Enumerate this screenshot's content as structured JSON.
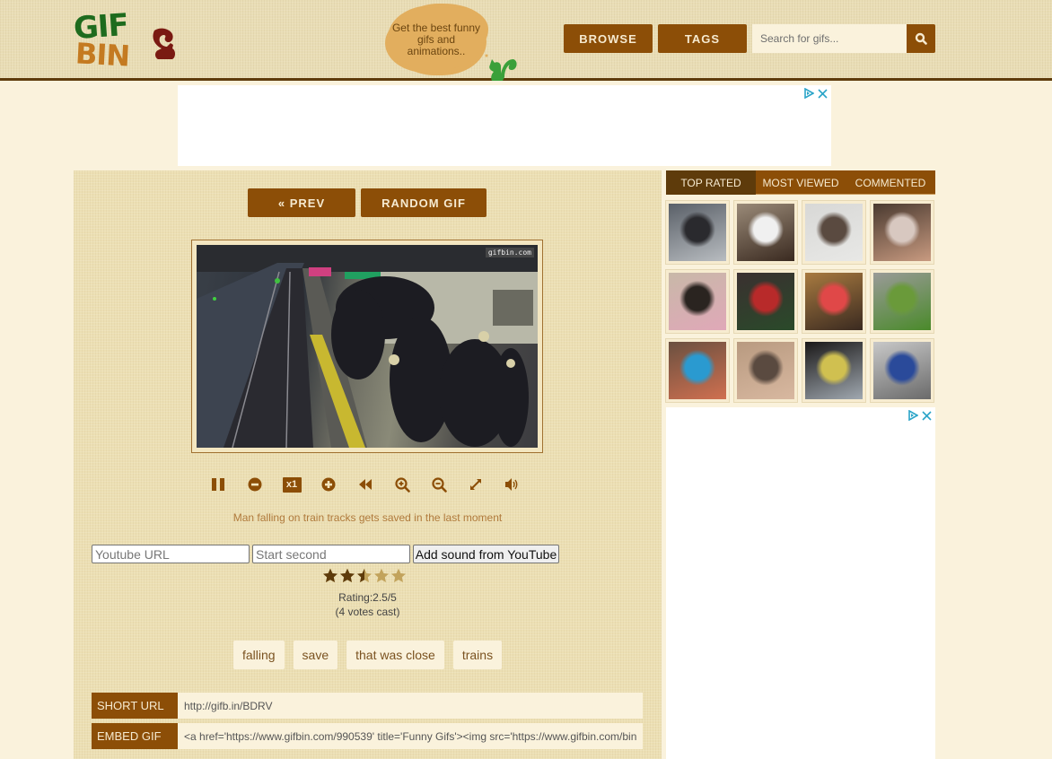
{
  "header": {
    "logo": {
      "line1": "GIF",
      "line2": "BIN"
    },
    "tagline": "Get the best funny gifs and animations..",
    "nav": [
      {
        "label": "BROWSE"
      },
      {
        "label": "TAGS"
      }
    ],
    "search": {
      "placeholder": "Search for gifs...",
      "value": "",
      "button_icon": "search-icon"
    }
  },
  "ads": {
    "icons": [
      "adchoices-icon",
      "close-icon"
    ]
  },
  "player": {
    "prev_label": "« PREV",
    "random_label": "RANDOM GIF",
    "watermark": "gifbin.com",
    "controls": [
      {
        "name": "pause",
        "icon": "pause-icon"
      },
      {
        "name": "slower",
        "icon": "minus-circle-icon"
      },
      {
        "name": "speed",
        "label": "x1"
      },
      {
        "name": "faster",
        "icon": "plus-circle-icon"
      },
      {
        "name": "rewind",
        "icon": "rewind-icon"
      },
      {
        "name": "zoom-in",
        "icon": "zoom-in-icon"
      },
      {
        "name": "zoom-out",
        "icon": "zoom-out-icon"
      },
      {
        "name": "fullscreen",
        "icon": "expand-icon"
      },
      {
        "name": "sound",
        "icon": "volume-icon"
      }
    ],
    "caption": "Man falling on train tracks gets saved in the last moment"
  },
  "sound": {
    "youtube_url_placeholder": "Youtube URL",
    "start_second_placeholder": "Start second",
    "button_label": "Add sound from YouTube"
  },
  "rating": {
    "value": 2.5,
    "max": 5,
    "label": "Rating:2.5/5",
    "votes_label": "(4 votes cast)"
  },
  "tags": [
    "falling",
    "save",
    "that was close",
    "trains"
  ],
  "share": {
    "short_url_label": "SHORT URL",
    "short_url_value": "http://gifb.in/BDRV",
    "embed_label": "EMBED GIF",
    "embed_value": "<a href='https://www.gifbin.com/990539' title='Funny Gifs'><img src='https://www.gifbin.com/bin"
  },
  "sidebar": {
    "tabs": [
      {
        "label": "TOP RATED",
        "active": true
      },
      {
        "label": "MOST VIEWED",
        "active": false
      },
      {
        "label": "COMMENTED",
        "active": false
      }
    ],
    "thumbnails": [
      {
        "desc": "person in kitchen",
        "colors": [
          "#5a6068",
          "#2a2a2e",
          "#b8bcc0"
        ]
      },
      {
        "desc": "woman selfie in robe",
        "colors": [
          "#9a8a78",
          "#f0f0f0",
          "#3a2a20"
        ]
      },
      {
        "desc": "boxer dog",
        "colors": [
          "#d8d8d6",
          "#5a4a40",
          "#e8e8e6"
        ]
      },
      {
        "desc": "shirtless man in bed",
        "colors": [
          "#4a3a30",
          "#d8c8c0",
          "#c89a80"
        ]
      },
      {
        "desc": "cat with pink blanket",
        "colors": [
          "#c8b8a8",
          "#2a2420",
          "#e0a8b8"
        ]
      },
      {
        "desc": "hockey fan in jersey",
        "colors": [
          "#3a3030",
          "#b82a2a",
          "#2a4a2a"
        ]
      },
      {
        "desc": "man in red shirt in room",
        "colors": [
          "#a87a40",
          "#e04848",
          "#3a2a20"
        ]
      },
      {
        "desc": "house with lawn",
        "colors": [
          "#9a9a98",
          "#6a9a3a",
          "#4a8a2a"
        ]
      },
      {
        "desc": "woman in blue top selfie",
        "colors": [
          "#6a5040",
          "#2a9ad0",
          "#d07050"
        ]
      },
      {
        "desc": "small animal in hand",
        "colors": [
          "#b89a80",
          "#5a4a40",
          "#d8b8a0"
        ]
      },
      {
        "desc": "dark close-up with rope",
        "colors": [
          "#1a1818",
          "#d0c050",
          "#a0a8b0"
        ]
      },
      {
        "desc": "truck and street",
        "colors": [
          "#c8c8c8",
          "#2a4a9a",
          "#6a6a6a"
        ]
      }
    ]
  }
}
